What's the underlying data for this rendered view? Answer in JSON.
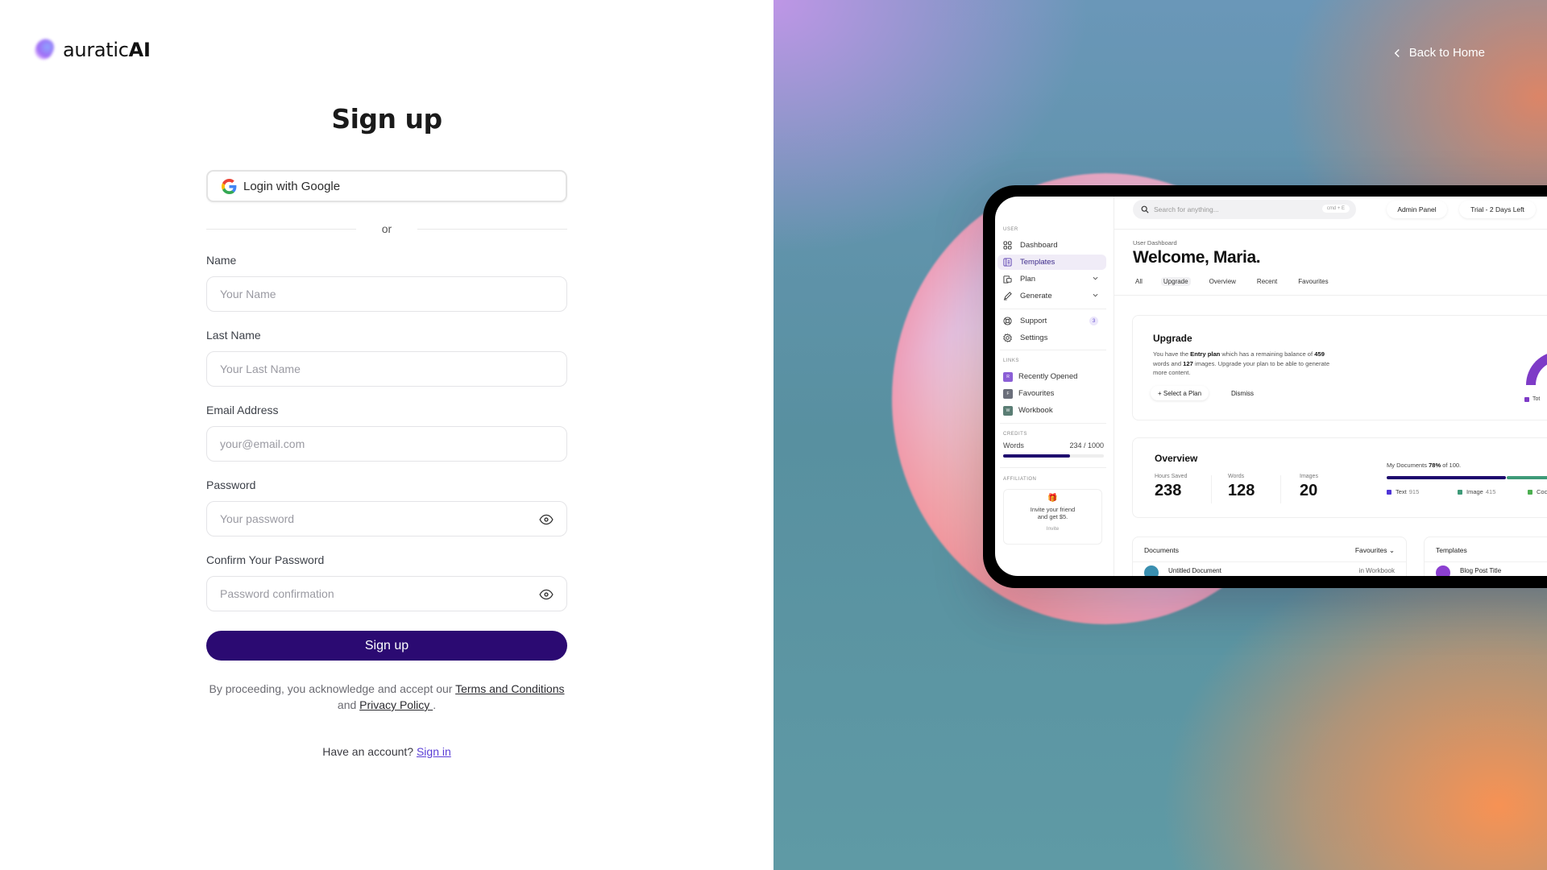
{
  "brand": {
    "name_light": "auratic",
    "name_bold": "AI"
  },
  "signup": {
    "title": "Sign up",
    "google_button": "Login with Google",
    "divider": "or",
    "fields": [
      {
        "label": "Name",
        "placeholder": "Your Name",
        "value": ""
      },
      {
        "label": "Last Name",
        "placeholder": "Your Last Name",
        "value": ""
      },
      {
        "label": "Email Address",
        "placeholder": "your@email.com",
        "value": ""
      },
      {
        "label": "Password",
        "placeholder": "Your password",
        "value": ""
      },
      {
        "label": "Confirm Your Password",
        "placeholder": "Password confirmation",
        "value": ""
      }
    ],
    "submit": "Sign up",
    "terms_prefix": "By proceeding, you acknowledge and accept our",
    "terms_link": "Terms and Conditions",
    "terms_and": "and",
    "privacy_link": "Privacy Policy ",
    "terms_suffix": ".",
    "have_account": "Have an account?",
    "sign_in": "Sign in"
  },
  "hero": {
    "back_home": "Back to Home",
    "accent_color": "#2b0a72",
    "mockup": {
      "search_placeholder": "Search for anything...",
      "search_shortcut": "cmd + E",
      "admin_panel": "Admin Panel",
      "trial": "Trial - 2 Days Left",
      "sidebar": {
        "user_section": "USER",
        "items": [
          {
            "label": "Dashboard",
            "icon": "grid-icon"
          },
          {
            "label": "Templates",
            "icon": "template-icon",
            "active": true
          },
          {
            "label": "Plan",
            "icon": "wallet-icon",
            "expandable": true
          },
          {
            "label": "Generate",
            "icon": "pen-icon",
            "expandable": true
          }
        ],
        "support": {
          "label": "Support",
          "badge": "3"
        },
        "settings": "Settings",
        "links_section": "LINKS",
        "links": [
          {
            "letter": "R",
            "label": "Recently Opened",
            "color": "#8b5fd6"
          },
          {
            "letter": "F",
            "label": "Favourites",
            "color": "#6b6f7b"
          },
          {
            "letter": "W",
            "label": "Workbook",
            "color": "#5a7d74"
          }
        ],
        "credits_section": "CREDITS",
        "credits_label": "Words",
        "credits_value": "234 / 1000",
        "credits_fraction": 0.66,
        "affiliation_section": "AFFILIATION",
        "affiliation_text_1": "Invite your friend",
        "affiliation_text_2": "and get $5.",
        "affiliation_action": "Invite"
      },
      "breadcrumb": "User Dashboard",
      "welcome": "Welcome, Maria.",
      "tabs": [
        "All",
        "Upgrade",
        "Overview",
        "Recent",
        "Favourites"
      ],
      "active_tab": "Upgrade",
      "upgrade": {
        "title": "Upgrade",
        "text_1": "You have the ",
        "plan": "Entry plan",
        "text_2": " which has a remaining balance of ",
        "words": "459",
        "text_3": " words and ",
        "images": "127",
        "text_4": " images. Upgrade your plan to be able to generate more content.",
        "select_plan": "+ Select a Plan",
        "dismiss": "Dismiss",
        "gauge_legend": "Tot"
      },
      "overview": {
        "title": "Overview",
        "stats": [
          {
            "label": "Hours Saved",
            "value": "238"
          },
          {
            "label": "Words",
            "value": "128"
          },
          {
            "label": "Images",
            "value": "20"
          }
        ],
        "docs_prefix": "My Documents ",
        "docs_percent": "78%",
        "docs_suffix": " of 100.",
        "legend": [
          {
            "label": "Text",
            "value": "915",
            "color": "#4f35d6"
          },
          {
            "label": "Image",
            "value": "415",
            "color": "#3e9a78"
          },
          {
            "label": "Coc",
            "value": "",
            "color": "#4caf50"
          }
        ]
      },
      "documents": {
        "title": "Documents",
        "filter": "Favourites",
        "row_title": "Untitled Document",
        "row_meta": "in Workbook"
      },
      "templates": {
        "title": "Templates",
        "row_title": "Blog Post Title"
      }
    }
  }
}
